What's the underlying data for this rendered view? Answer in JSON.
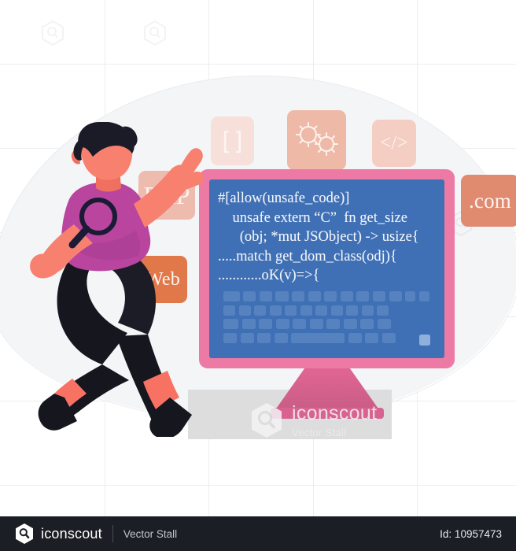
{
  "illustration": {
    "title": "Developer inspecting code on monitor",
    "code_screen": {
      "lines": [
        "#[allow(unsafe_code)]",
        "    unsafe extern “C”  fn get_size",
        "      (obj; *mut JSObject) -> usize{",
        ".....match get_dom_class(odj){",
        "............oK(v)=>{"
      ],
      "screen_color": "#3f6fb4",
      "bezel_color": "#ec7aa4"
    },
    "tags": [
      {
        "id": "brackets",
        "label": "[  ]",
        "color": "#f7e0da",
        "icon": "brackets-icon"
      },
      {
        "id": "bugs",
        "label": "",
        "color": "#efb9a8",
        "icon": "bug-icon"
      },
      {
        "id": "code",
        "label": "</>",
        "color": "#f4cec2",
        "icon": "code-tag-icon"
      },
      {
        "id": "php",
        "label": "PHP",
        "color": "#eebcae",
        "icon": "php-tag"
      },
      {
        "id": "com",
        "label": ".com",
        "color": "#e08a70",
        "icon": "dotcom-tag"
      },
      {
        "id": "web",
        "label": "Web",
        "color": "#e0784a",
        "icon": "web-tag"
      }
    ],
    "character": {
      "name": "running-developer",
      "hair_color": "#1b1b28",
      "skin_color": "#f7806f",
      "shirt_color": "#b9459f",
      "pants_color": "#16161f",
      "cuff_color": "#f87264",
      "magnifier_color": "#1b1b35"
    },
    "watermark": {
      "name": "iconscout",
      "subtitle": "Vector Stall"
    }
  },
  "footer": {
    "brand": "iconscout",
    "author": "Vector Stall",
    "id_label": "Id: 10957473"
  }
}
